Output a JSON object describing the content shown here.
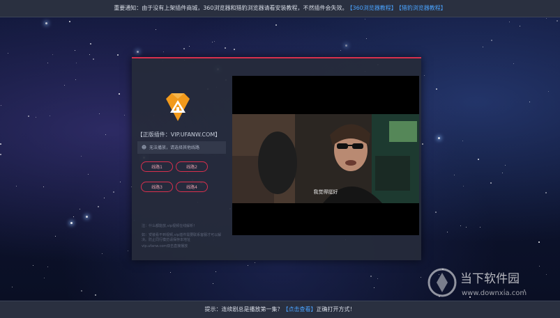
{
  "top_notice": {
    "text": "重要通知：由于没有上架插件商城，360浏览器和猎豹浏览器请看安装教程，不然插件会失效。",
    "link_360": "【360浏览器教程】",
    "link_liebao": "【猎豹浏览器教程】"
  },
  "panel": {
    "site_label": "【正版插件：VIP.UFANW.COM】",
    "notice_text": "无法播放，请选择其他线路",
    "lines": [
      "线路1",
      "线路2",
      "线路3",
      "线路4"
    ],
    "hint_1": "注：什么都能放,vip视频在线解析！",
    "hint_2": "如：安装看不到视频,vip插件需要联系客服才可以解决。防止同行模仿请保存本地址",
    "hint_3": "vip.ufanw.com双击直接播放"
  },
  "player": {
    "subtitle": "我觉得挺好"
  },
  "bottom_notice": {
    "prefix": "提示：连续剧总是播放第一集？",
    "link": "【点击查看】",
    "suffix": "正确打开方式！"
  },
  "watermark": {
    "brand": "当下软件园",
    "url": "www.downxia.com"
  },
  "colors": {
    "accent_red": "#d9304e",
    "link_blue": "#4aa3ff",
    "logo_orange": "#f29a1c"
  }
}
